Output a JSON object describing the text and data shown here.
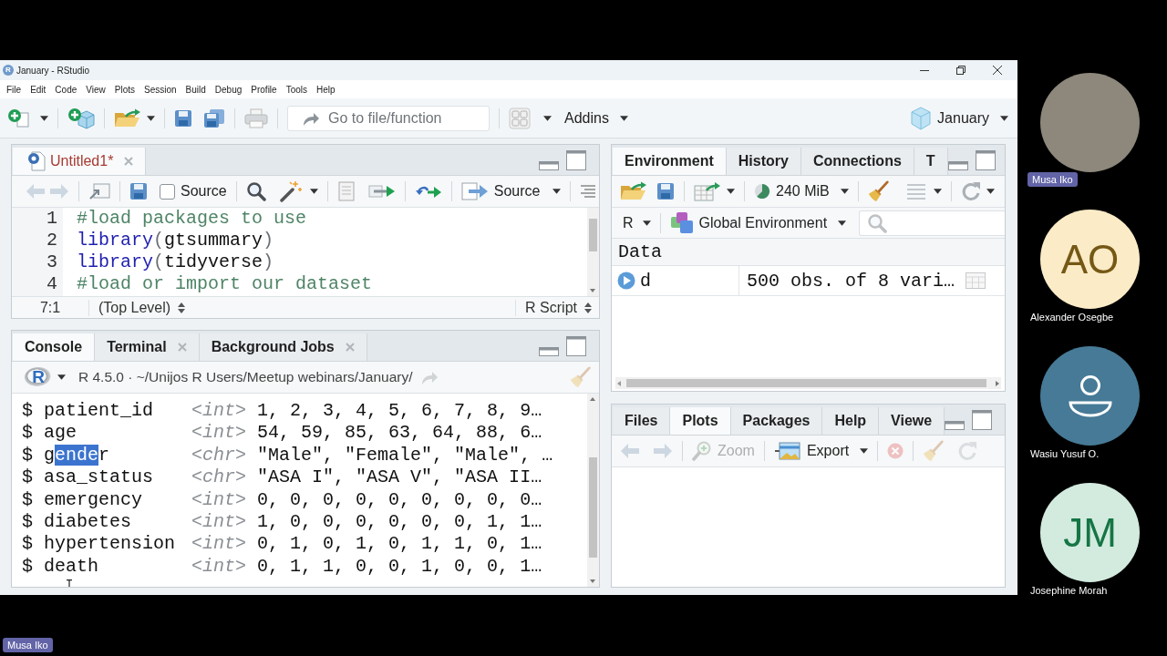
{
  "window": {
    "logo": "R",
    "title": "January - RStudio"
  },
  "menu": [
    "File",
    "Edit",
    "Code",
    "View",
    "Plots",
    "Session",
    "Build",
    "Debug",
    "Profile",
    "Tools",
    "Help"
  ],
  "toolbar": {
    "goto": {
      "placeholder": "Go to file/function"
    },
    "addins": "Addins",
    "project": "January"
  },
  "editor": {
    "tabs": [
      {
        "label": "Untitled1*",
        "selected": true,
        "unsaved": true,
        "closable": true
      }
    ],
    "toolbar": {
      "history_disabled": true,
      "source_on_save": {
        "label": "Source",
        "checked": false
      },
      "source_button": "Source"
    },
    "lines": [
      {
        "number": "1",
        "tokens": [
          {
            "kind": "comment",
            "text": "#load packages to use"
          }
        ]
      },
      {
        "number": "2",
        "tokens": [
          {
            "kind": "function",
            "text": "library"
          },
          {
            "kind": "paren",
            "text": "("
          },
          {
            "kind": "plain",
            "text": "gtsummary"
          },
          {
            "kind": "paren",
            "text": ")"
          }
        ]
      },
      {
        "number": "3",
        "tokens": [
          {
            "kind": "function",
            "text": "library"
          },
          {
            "kind": "paren",
            "text": "("
          },
          {
            "kind": "plain",
            "text": "tidyverse"
          },
          {
            "kind": "paren",
            "text": ")"
          }
        ]
      },
      {
        "number": "4",
        "tokens": [
          {
            "kind": "comment",
            "text": "#load or import our dataset"
          }
        ]
      }
    ],
    "status": {
      "position": "7:1",
      "scope": "(Top Level)",
      "file_type": "R Script"
    }
  },
  "console": {
    "tabs": [
      {
        "label": "Console",
        "selected": true,
        "closable": false
      },
      {
        "label": "Terminal",
        "selected": false,
        "closable": true
      },
      {
        "label": "Background Jobs",
        "selected": false,
        "closable": true
      }
    ],
    "logo": "R",
    "session": "R 4.5.0 · ~/Unijos R Users/Meetup webinars/January/",
    "lines": [
      {
        "prefix": "$",
        "name": [
          {
            "text": "patient_id",
            "selected": false
          }
        ],
        "type": "<int>",
        "values": "1, 2, 3, 4, 5, 6, 7, 8, 9…"
      },
      {
        "prefix": "$",
        "name": [
          {
            "text": "age",
            "selected": false
          }
        ],
        "type": "<int>",
        "values": "54, 59, 85, 63, 64, 88, 6…"
      },
      {
        "prefix": "$",
        "name": [
          {
            "text": "g",
            "selected": false
          },
          {
            "text": "ende",
            "selected": true
          },
          {
            "text": "r",
            "selected": false
          }
        ],
        "type": "<chr>",
        "values": "\"Male\", \"Female\", \"Male\", …"
      },
      {
        "prefix": "$",
        "name": [
          {
            "text": "asa_status",
            "selected": false
          }
        ],
        "type": "<chr>",
        "values": "\"ASA I\", \"ASA V\", \"ASA II…"
      },
      {
        "prefix": "$",
        "name": [
          {
            "text": "emergency",
            "selected": false
          }
        ],
        "type": "<int>",
        "values": "0, 0, 0, 0, 0, 0, 0, 0, 0…"
      },
      {
        "prefix": "$",
        "name": [
          {
            "text": "diabetes",
            "selected": false
          }
        ],
        "type": "<int>",
        "values": "1, 0, 0, 0, 0, 0, 0, 1, 1…"
      },
      {
        "prefix": "$",
        "name": [
          {
            "text": "hypertension",
            "selected": false
          }
        ],
        "type": "<int>",
        "values": "0, 1, 0, 1, 0, 1, 1, 0, 1…"
      },
      {
        "prefix": "$",
        "name": [
          {
            "text": "death",
            "selected": false
          }
        ],
        "type": "<int>",
        "values": "0, 1, 1, 0, 0, 1, 0, 0, 1…"
      }
    ]
  },
  "environment": {
    "tabs": [
      {
        "label": "Environment",
        "selected": true
      },
      {
        "label": "History",
        "selected": false
      },
      {
        "label": "Connections",
        "selected": false
      },
      {
        "label": "T",
        "selected": false
      }
    ],
    "memory": "240 MiB",
    "language": "R",
    "scope": "Global Environment",
    "section": "Data",
    "rows": [
      {
        "name": "d",
        "value": "500 obs. of 8 vari…"
      }
    ]
  },
  "files": {
    "tabs": [
      {
        "label": "Files",
        "selected": false
      },
      {
        "label": "Plots",
        "selected": true
      },
      {
        "label": "Packages",
        "selected": false
      },
      {
        "label": "Help",
        "selected": false
      },
      {
        "label": "Viewe",
        "selected": false
      }
    ],
    "tools": [
      {
        "kind": "back",
        "disabled": true
      },
      {
        "kind": "forward",
        "disabled": true
      },
      {
        "kind": "zoom",
        "label": "Zoom",
        "disabled": true
      },
      {
        "kind": "export",
        "label": "Export",
        "disabled": false
      },
      {
        "kind": "remove",
        "disabled": true
      },
      {
        "kind": "broom",
        "disabled": true
      },
      {
        "kind": "refresh",
        "disabled": true
      }
    ]
  },
  "participants": [
    {
      "kind": "video",
      "name": "Musa Iko"
    },
    {
      "kind": "initials",
      "initials": "AO",
      "name": "Alexander Osegbe",
      "color": "#fbebc7"
    },
    {
      "kind": "silhouette",
      "name": "Wasiu Yusuf O.",
      "color": "#467a96"
    },
    {
      "kind": "initials",
      "initials": "JM",
      "name": "Josephine Morah",
      "color": "#d3ebdf"
    }
  ],
  "presenter": "Musa Iko"
}
